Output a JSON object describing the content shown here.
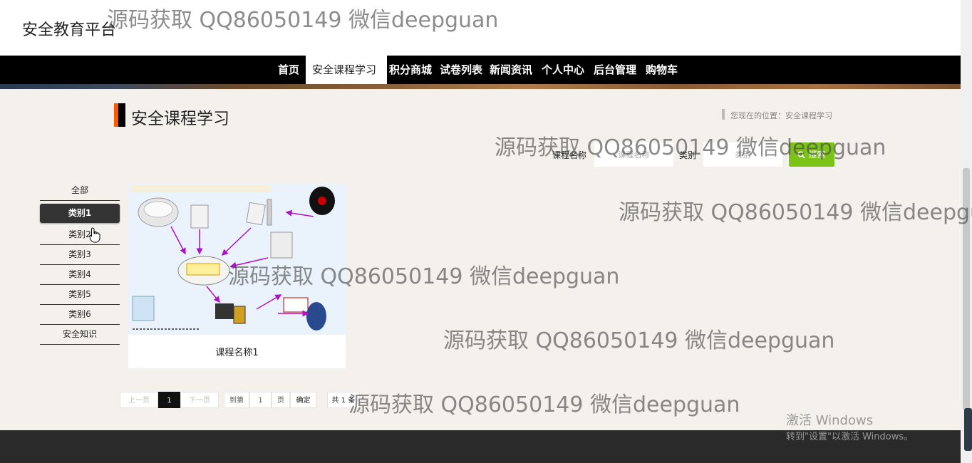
{
  "brand": "安全教育平台",
  "nav": [
    "首页",
    "安全课程学习",
    "积分商城",
    "试卷列表",
    "新闻资讯",
    "个人中心",
    "后台管理",
    "购物车"
  ],
  "page_title": "安全课程学习",
  "breadcrumb": "您现在的位置：安全课程学习",
  "search": {
    "name_label": "课程名称",
    "name_placeholder": "课程名称",
    "type_label": "类别",
    "type_placeholder": "类别",
    "button": "搜索",
    "button_icon": "search-icon"
  },
  "categories": [
    "全部",
    "类别1",
    "类别2",
    "类别3",
    "类别4",
    "类别5",
    "类别6",
    "安全知识"
  ],
  "active_category": "类别1",
  "courses": [
    {
      "title": "课程名称1"
    }
  ],
  "pagination": {
    "prev": "上一页",
    "current": "1",
    "next": "下一页",
    "goto_label": "到第",
    "goto_value": "1",
    "page_unit": "页",
    "confirm": "确定",
    "total": "共 1 条"
  },
  "watermark": "源码获取 QQ86050149 微信deepguan",
  "windows_activation": {
    "title": "激活 Windows",
    "subtitle": "转到\"设置\"以激活 Windows。"
  },
  "colors": {
    "accent": "#ff5a00",
    "search_button": "#7cc317",
    "nav_bg": "#000000",
    "page_bg": "#f4f0ec"
  }
}
